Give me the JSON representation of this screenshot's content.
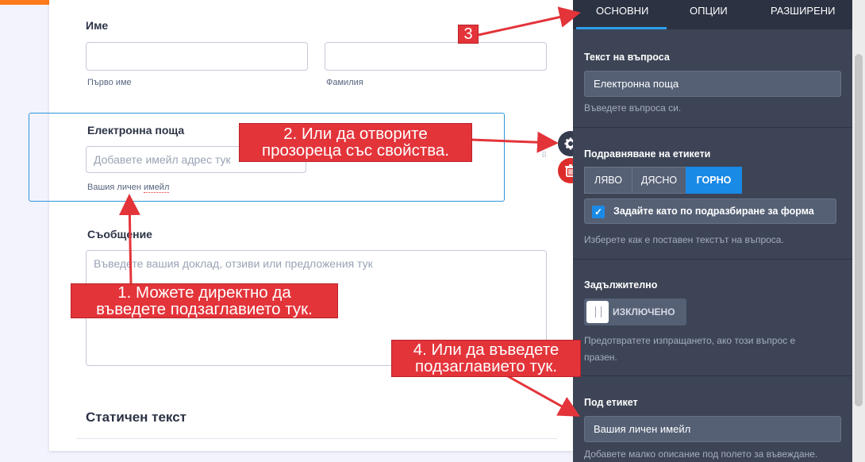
{
  "form": {
    "name": {
      "label": "Име",
      "first_sublabel": "Първо име",
      "last_sublabel": "Фамилия"
    },
    "email": {
      "label": "Електронна поща",
      "placeholder": "Добавете имейл адрес тук",
      "sublabel_part1": "Вашия личен ",
      "sublabel_part2": "имейл"
    },
    "message": {
      "label": "Съобщение",
      "placeholder": "Въведете вашия доклад, отзиви или предложения тук"
    },
    "static_text": "Статичен текст"
  },
  "panel": {
    "tabs": [
      "ОСНОВНИ",
      "ОПЦИИ",
      "РАЗШИРЕНИ"
    ],
    "question_text": {
      "label": "Текст на въпроса",
      "value": "Електронна поща",
      "hint": "Въведете въпроса си."
    },
    "label_alignment": {
      "label": "Подравняване на етикети",
      "options": [
        "ЛЯВО",
        "ДЯСНО",
        "ГОРНО"
      ],
      "selected": "ГОРНО",
      "default_checkbox": "Задайте като по подразбиране за форма",
      "hint": "Изберете как е поставен текстът на въпроса."
    },
    "required": {
      "label": "Задължително",
      "toggle": "ИЗКЛЮЧЕНО",
      "hint_line1": "Предотвратете изпращането, ако този въпрос е",
      "hint_line2": "празен."
    },
    "sublabel": {
      "label": "Под етикет",
      "value": "Вашия личен имейл",
      "hint": "Добавете малко описание под полето за въвеждане."
    }
  },
  "callouts": {
    "c1_line1": "1. Можете директно да",
    "c1_line2": "въведете подзаглавието тук.",
    "c2_line1": "2. Или да отворите",
    "c2_line2": "прозореца със свойства.",
    "c3": "3",
    "c4_line1": "4. Или да въведете",
    "c4_line2": "подзаглавието тук."
  },
  "colors": {
    "accent": "#1a8ae7",
    "topbar": "#ff7a1a",
    "panel_bg": "#3c4455",
    "callout": "#e3343a"
  }
}
